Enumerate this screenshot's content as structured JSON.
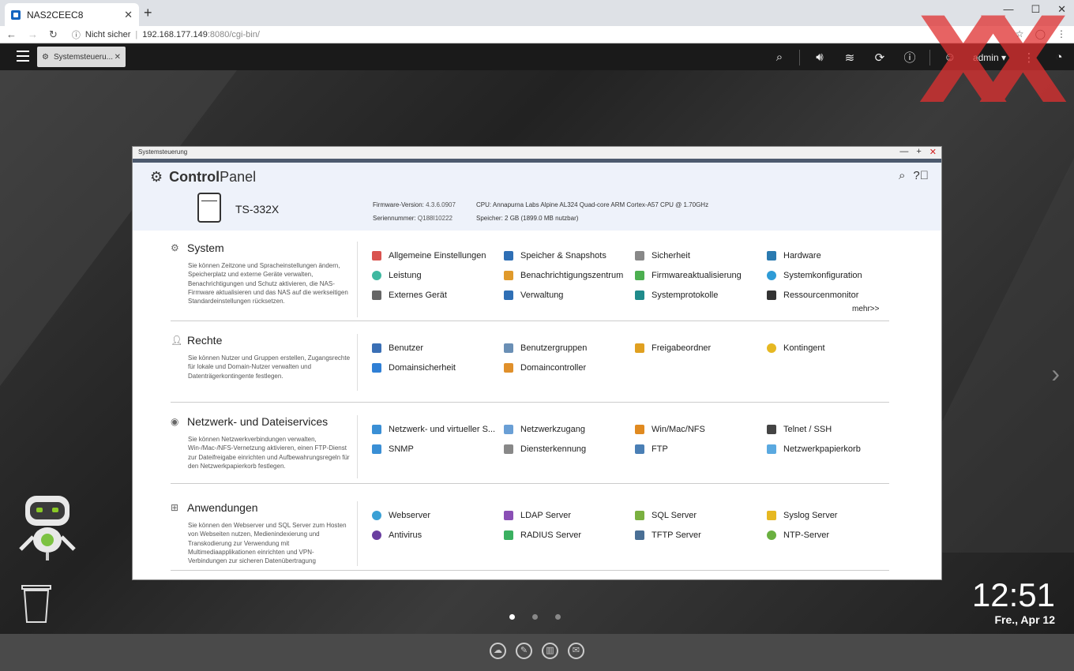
{
  "browser": {
    "tab_title": "NAS2CEEC8",
    "new_tab": "+",
    "security": "Nicht sicher",
    "url_host": "192.168.177.149",
    "url_path": ":8080/cgi-bin/"
  },
  "qts": {
    "task_label": "Systemsteueru...",
    "user": "admin ▾"
  },
  "window": {
    "title": "Systemsteuerung",
    "logo_bold": "Control",
    "logo_rest": "Panel",
    "model": "TS-332X",
    "firmware_label": "Firmware-Version:",
    "firmware_value": "4.3.6.0907",
    "serial_label": "Seriennummer:",
    "serial_value": "Q188I10222",
    "cpu_label": "CPU:",
    "cpu_value": "Annapurna Labs Alpine AL324 Quad-core ARM Cortex-A57 CPU @ 1.70GHz",
    "mem_label": "Speicher:",
    "mem_value": "2 GB (1899.0 MB nutzbar)"
  },
  "sections": [
    {
      "title": "System",
      "desc": "Sie können Zeitzone und Spracheinstellungen ändern, Speicherplatz und externe Geräte verwalten, Benachrichtigungen und Schutz aktivieren, die NAS-Firmware aktualisieren und das NAS auf die werkseitigen Standardeinstellungen rücksetzen.",
      "items": [
        "Allgemeine Einstellungen",
        "Speicher & Snapshots",
        "Sicherheit",
        "Hardware",
        "Leistung",
        "Benachrichtigungszentrum",
        "Firmwareaktualisierung",
        "Systemkonfiguration",
        "Externes Gerät",
        "Verwaltung",
        "Systemprotokolle",
        "Ressourcenmonitor"
      ],
      "more": "mehr>>"
    },
    {
      "title": "Rechte",
      "desc": "Sie können Nutzer und Gruppen erstellen, Zugangsrechte für lokale und Domain-Nutzer verwalten und Datenträgerkontingente festlegen.",
      "items": [
        "Benutzer",
        "Benutzergruppen",
        "Freigabeordner",
        "Kontingent",
        "Domainsicherheit",
        "Domaincontroller"
      ]
    },
    {
      "title": "Netzwerk- und Dateiservices",
      "desc": "Sie können Netzwerkverbindungen verwalten, Win-/Mac-/NFS-Vernetzung aktivieren, einen FTP-Dienst zur Dateifreigabe einrichten und Aufbewahrungsregeln für den Netzwerkpapierkorb festlegen.",
      "items": [
        "Netzwerk- und virtueller S...",
        "Netzwerkzugang",
        "Win/Mac/NFS",
        "Telnet / SSH",
        "SNMP",
        "Diensterkennung",
        "FTP",
        "Netzwerkpapierkorb"
      ]
    },
    {
      "title": "Anwendungen",
      "desc": "Sie können den Webserver und SQL Server zum Hosten von Webseiten nutzen, Medienindexierung und Transkodierung zur Verwendung mit Multimediaapplikationen einrichten und VPN-Verbindungen zur sicheren Datenübertragung",
      "items": [
        "Webserver",
        "LDAP Server",
        "SQL Server",
        "Syslog Server",
        "Antivirus",
        "RADIUS Server",
        "TFTP Server",
        "NTP-Server"
      ]
    }
  ],
  "desktop": {
    "time": "12:51",
    "date": "Fre., Apr 12"
  },
  "colors": {
    "accent": "#4d5a6e",
    "header_bg": "#eef2fa",
    "watermark": "#e03030"
  }
}
